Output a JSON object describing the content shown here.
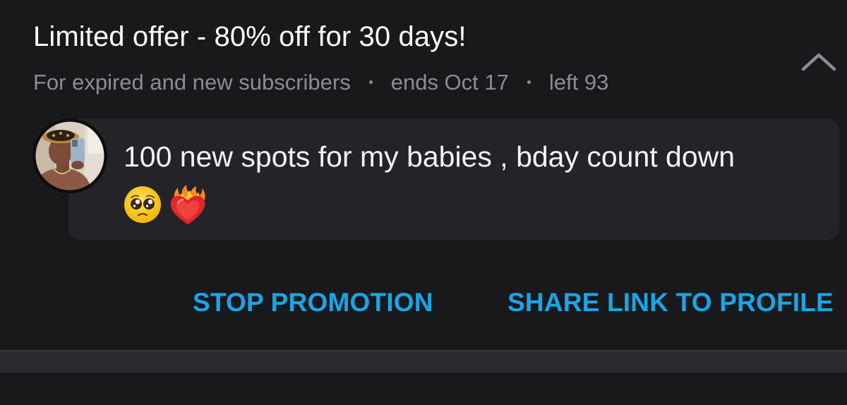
{
  "promo": {
    "title": "Limited offer - 80% off for 30 days!",
    "audience": "For expired and new subscribers",
    "ends": "ends Oct 17",
    "left": "left 93",
    "collapse_icon": "chevron-up-icon"
  },
  "message": {
    "avatar": "avatar",
    "text": "100 new spots for my babies , bday count down",
    "emojis": [
      "pleading-face-emoji",
      "heart-on-fire-emoji"
    ]
  },
  "actions": {
    "stop_label": "STOP PROMOTION",
    "share_label": "SHARE LINK TO PROFILE"
  },
  "colors": {
    "background": "#19191c",
    "bubble": "#242428",
    "accent": "#1aa5e6",
    "muted": "#8a8d93"
  }
}
